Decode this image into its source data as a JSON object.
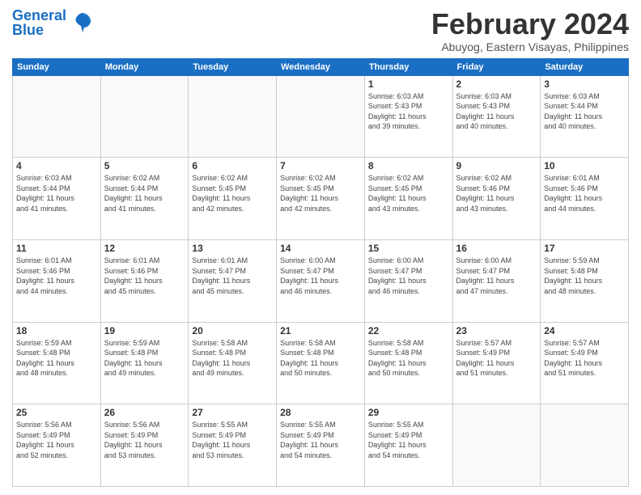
{
  "logo": {
    "line1": "General",
    "line2": "Blue"
  },
  "title": "February 2024",
  "location": "Abuyog, Eastern Visayas, Philippines",
  "days_of_week": [
    "Sunday",
    "Monday",
    "Tuesday",
    "Wednesday",
    "Thursday",
    "Friday",
    "Saturday"
  ],
  "weeks": [
    [
      {
        "day": "",
        "info": ""
      },
      {
        "day": "",
        "info": ""
      },
      {
        "day": "",
        "info": ""
      },
      {
        "day": "",
        "info": ""
      },
      {
        "day": "1",
        "info": "Sunrise: 6:03 AM\nSunset: 5:43 PM\nDaylight: 11 hours\nand 39 minutes."
      },
      {
        "day": "2",
        "info": "Sunrise: 6:03 AM\nSunset: 5:43 PM\nDaylight: 11 hours\nand 40 minutes."
      },
      {
        "day": "3",
        "info": "Sunrise: 6:03 AM\nSunset: 5:44 PM\nDaylight: 11 hours\nand 40 minutes."
      }
    ],
    [
      {
        "day": "4",
        "info": "Sunrise: 6:03 AM\nSunset: 5:44 PM\nDaylight: 11 hours\nand 41 minutes."
      },
      {
        "day": "5",
        "info": "Sunrise: 6:02 AM\nSunset: 5:44 PM\nDaylight: 11 hours\nand 41 minutes."
      },
      {
        "day": "6",
        "info": "Sunrise: 6:02 AM\nSunset: 5:45 PM\nDaylight: 11 hours\nand 42 minutes."
      },
      {
        "day": "7",
        "info": "Sunrise: 6:02 AM\nSunset: 5:45 PM\nDaylight: 11 hours\nand 42 minutes."
      },
      {
        "day": "8",
        "info": "Sunrise: 6:02 AM\nSunset: 5:45 PM\nDaylight: 11 hours\nand 43 minutes."
      },
      {
        "day": "9",
        "info": "Sunrise: 6:02 AM\nSunset: 5:46 PM\nDaylight: 11 hours\nand 43 minutes."
      },
      {
        "day": "10",
        "info": "Sunrise: 6:01 AM\nSunset: 5:46 PM\nDaylight: 11 hours\nand 44 minutes."
      }
    ],
    [
      {
        "day": "11",
        "info": "Sunrise: 6:01 AM\nSunset: 5:46 PM\nDaylight: 11 hours\nand 44 minutes."
      },
      {
        "day": "12",
        "info": "Sunrise: 6:01 AM\nSunset: 5:46 PM\nDaylight: 11 hours\nand 45 minutes."
      },
      {
        "day": "13",
        "info": "Sunrise: 6:01 AM\nSunset: 5:47 PM\nDaylight: 11 hours\nand 45 minutes."
      },
      {
        "day": "14",
        "info": "Sunrise: 6:00 AM\nSunset: 5:47 PM\nDaylight: 11 hours\nand 46 minutes."
      },
      {
        "day": "15",
        "info": "Sunrise: 6:00 AM\nSunset: 5:47 PM\nDaylight: 11 hours\nand 46 minutes."
      },
      {
        "day": "16",
        "info": "Sunrise: 6:00 AM\nSunset: 5:47 PM\nDaylight: 11 hours\nand 47 minutes."
      },
      {
        "day": "17",
        "info": "Sunrise: 5:59 AM\nSunset: 5:48 PM\nDaylight: 11 hours\nand 48 minutes."
      }
    ],
    [
      {
        "day": "18",
        "info": "Sunrise: 5:59 AM\nSunset: 5:48 PM\nDaylight: 11 hours\nand 48 minutes."
      },
      {
        "day": "19",
        "info": "Sunrise: 5:59 AM\nSunset: 5:48 PM\nDaylight: 11 hours\nand 49 minutes."
      },
      {
        "day": "20",
        "info": "Sunrise: 5:58 AM\nSunset: 5:48 PM\nDaylight: 11 hours\nand 49 minutes."
      },
      {
        "day": "21",
        "info": "Sunrise: 5:58 AM\nSunset: 5:48 PM\nDaylight: 11 hours\nand 50 minutes."
      },
      {
        "day": "22",
        "info": "Sunrise: 5:58 AM\nSunset: 5:48 PM\nDaylight: 11 hours\nand 50 minutes."
      },
      {
        "day": "23",
        "info": "Sunrise: 5:57 AM\nSunset: 5:49 PM\nDaylight: 11 hours\nand 51 minutes."
      },
      {
        "day": "24",
        "info": "Sunrise: 5:57 AM\nSunset: 5:49 PM\nDaylight: 11 hours\nand 51 minutes."
      }
    ],
    [
      {
        "day": "25",
        "info": "Sunrise: 5:56 AM\nSunset: 5:49 PM\nDaylight: 11 hours\nand 52 minutes."
      },
      {
        "day": "26",
        "info": "Sunrise: 5:56 AM\nSunset: 5:49 PM\nDaylight: 11 hours\nand 53 minutes."
      },
      {
        "day": "27",
        "info": "Sunrise: 5:55 AM\nSunset: 5:49 PM\nDaylight: 11 hours\nand 53 minutes."
      },
      {
        "day": "28",
        "info": "Sunrise: 5:55 AM\nSunset: 5:49 PM\nDaylight: 11 hours\nand 54 minutes."
      },
      {
        "day": "29",
        "info": "Sunrise: 5:55 AM\nSunset: 5:49 PM\nDaylight: 11 hours\nand 54 minutes."
      },
      {
        "day": "",
        "info": ""
      },
      {
        "day": "",
        "info": ""
      }
    ]
  ]
}
